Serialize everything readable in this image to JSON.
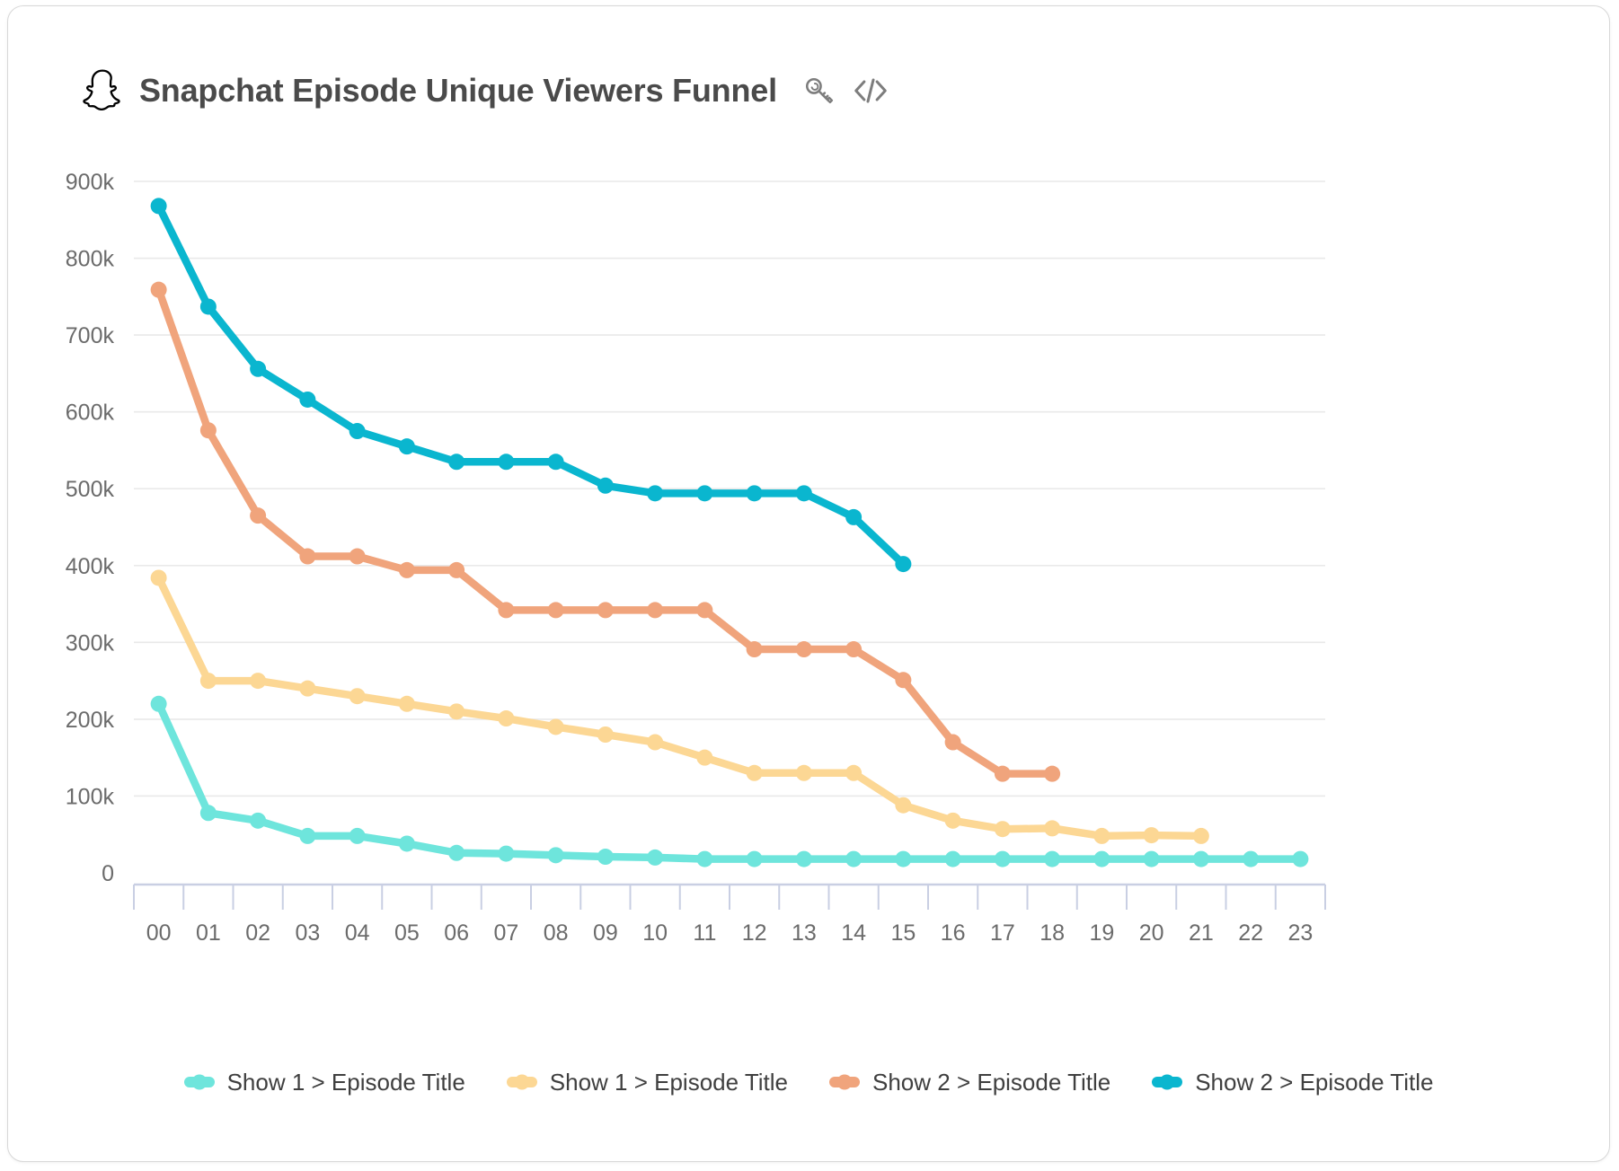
{
  "header": {
    "title": "Snapchat Episode Unique Viewers Funnel",
    "logo_icon": "snapchat-ghost-icon",
    "key_icon": "key-icon",
    "code_icon": "code-brackets-icon",
    "code_icon_glyph": "</>"
  },
  "colors": {
    "series_1": "#6EE5DC",
    "series_2": "#FCD794",
    "series_3": "#F0A47C",
    "series_4": "#0AB6CF",
    "grid": "#e9e9e9",
    "axis": "#c9cfe3",
    "tick_text": "#6b6b6b",
    "title_text": "#4a4a4a",
    "card_border": "#d8d8d8",
    "background": "#ffffff"
  },
  "chart_data": {
    "type": "line",
    "title": "Snapchat Episode Unique Viewers Funnel",
    "xlabel": "",
    "ylabel": "",
    "ylim": [
      0,
      900000
    ],
    "ytick_labels": [
      "0",
      "100k",
      "200k",
      "300k",
      "400k",
      "500k",
      "600k",
      "700k",
      "800k",
      "900k"
    ],
    "ytick_values": [
      0,
      100000,
      200000,
      300000,
      400000,
      500000,
      600000,
      700000,
      800000,
      900000
    ],
    "grid": true,
    "legend_position": "bottom",
    "categories": [
      "00",
      "01",
      "02",
      "03",
      "04",
      "05",
      "06",
      "07",
      "08",
      "09",
      "10",
      "11",
      "12",
      "13",
      "14",
      "15",
      "16",
      "17",
      "18",
      "19",
      "20",
      "21",
      "22",
      "23"
    ],
    "series": [
      {
        "name": "Show 1 > Episode Title",
        "color": "#6EE5DC",
        "values": [
          220000,
          78000,
          68000,
          48000,
          48000,
          38000,
          26000,
          25000,
          23000,
          21000,
          20000,
          18000,
          18000,
          18000,
          18000,
          18000,
          18000,
          18000,
          18000,
          18000,
          18000,
          18000,
          18000,
          18000
        ]
      },
      {
        "name": "Show 1 > Episode Title",
        "color": "#FCD794",
        "values": [
          384000,
          250000,
          250000,
          240000,
          230000,
          220000,
          210000,
          201000,
          190000,
          180000,
          170000,
          150000,
          130000,
          130000,
          130000,
          88000,
          68000,
          57000,
          58000,
          48000,
          49000,
          48000,
          null,
          null
        ]
      },
      {
        "name": "Show 2 > Episode Title",
        "color": "#F0A47C",
        "values": [
          759000,
          576000,
          465000,
          412000,
          412000,
          394000,
          394000,
          342000,
          342000,
          342000,
          342000,
          342000,
          291000,
          291000,
          291000,
          251000,
          170000,
          129000,
          129000,
          null,
          null,
          null,
          null,
          null
        ]
      },
      {
        "name": "Show 2 > Episode Title",
        "color": "#0AB6CF",
        "values": [
          868000,
          737000,
          656000,
          616000,
          575000,
          555000,
          535000,
          535000,
          535000,
          504000,
          494000,
          494000,
          494000,
          494000,
          463000,
          402000,
          null,
          null,
          null,
          null,
          null,
          null,
          null,
          null
        ]
      }
    ]
  },
  "legend": [
    {
      "label": "Show 1 > Episode Title",
      "color": "#6EE5DC"
    },
    {
      "label": "Show 1 > Episode Title",
      "color": "#FCD794"
    },
    {
      "label": "Show 2 > Episode Title",
      "color": "#F0A47C"
    },
    {
      "label": "Show 2 > Episode Title",
      "color": "#0AB6CF"
    }
  ]
}
